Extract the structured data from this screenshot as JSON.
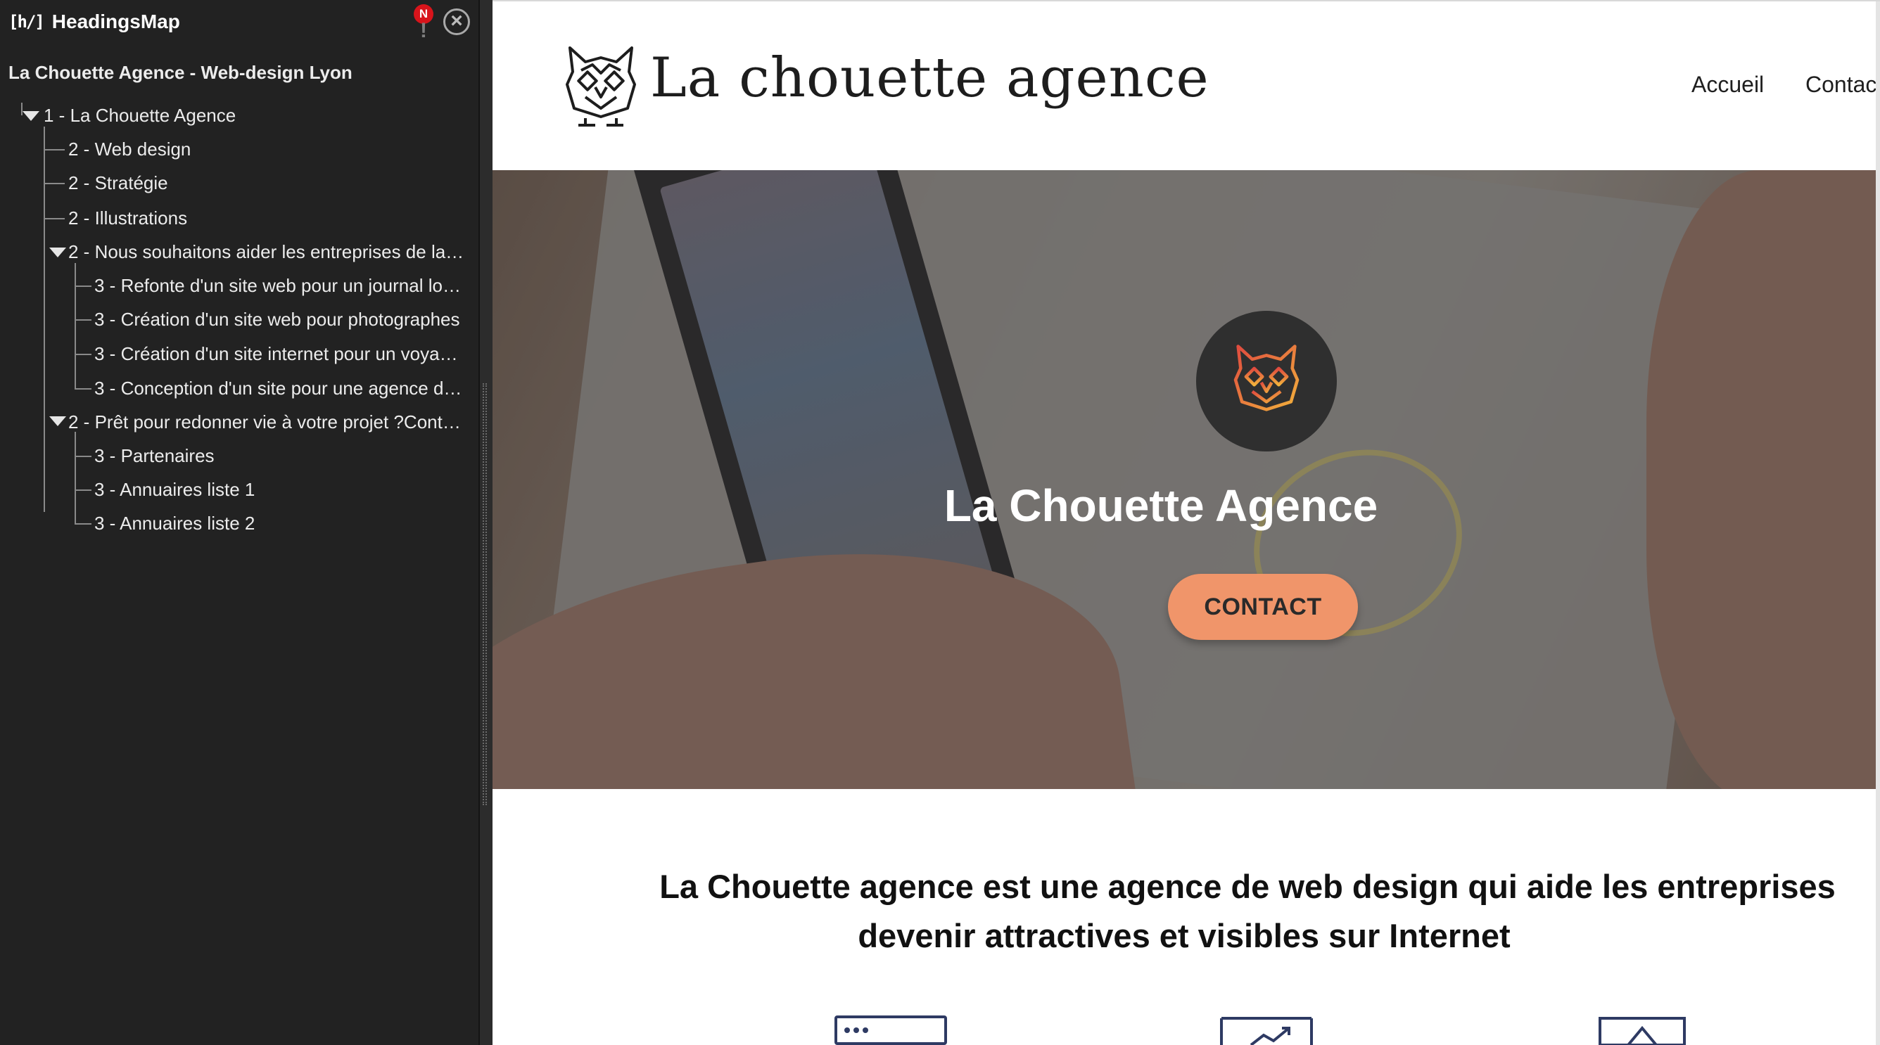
{
  "extension": {
    "title": "HeadingsMap",
    "logo_text": "[h/]",
    "warning_badge": "N",
    "warning_mark": "!",
    "close_glyph": "×",
    "document_title": "La Chouette Agence - Web-design Lyon",
    "headings": [
      {
        "text": "1 -  La Chouette Agence"
      },
      {
        "text": "2 - Web design"
      },
      {
        "text": "2 -  Stratégie"
      },
      {
        "text": "2 - Illustrations"
      },
      {
        "text": "2 -  Nous souhaitons aider les entreprises de la…"
      },
      {
        "text": "3 -  Refonte d'un site web pour un journal lo…"
      },
      {
        "text": "3 -  Création d'un site web pour photographes"
      },
      {
        "text": "3 -  Création d'un site internet pour un voya…"
      },
      {
        "text": "3 -  Conception d'un site pour une agence d…"
      },
      {
        "text": "2 -  Prêt pour redonner vie à votre projet ?Cont…"
      },
      {
        "text": "3 - Partenaires"
      },
      {
        "text": "3 - Annuaires liste 1"
      },
      {
        "text": "3 - Annuaires liste 2"
      }
    ]
  },
  "site": {
    "brand_name": "La chouette agence",
    "nav": [
      "Accueil",
      "Contac"
    ],
    "hero": {
      "title": "La Chouette Agence",
      "cta_label": "CONTACT"
    },
    "intro_line1": "La Chouette agence est une agence de web design qui aide les entreprises",
    "intro_line2": "devenir attractives et visibles sur Internet",
    "service_icons": [
      "browser-window-icon",
      "chart-growth-icon",
      "pen-tool-icon"
    ]
  },
  "colors": {
    "sidebar_bg": "#222222",
    "cta": "#f0956a",
    "badge_red": "#d8141b",
    "icon_navy": "#2e3a63"
  }
}
